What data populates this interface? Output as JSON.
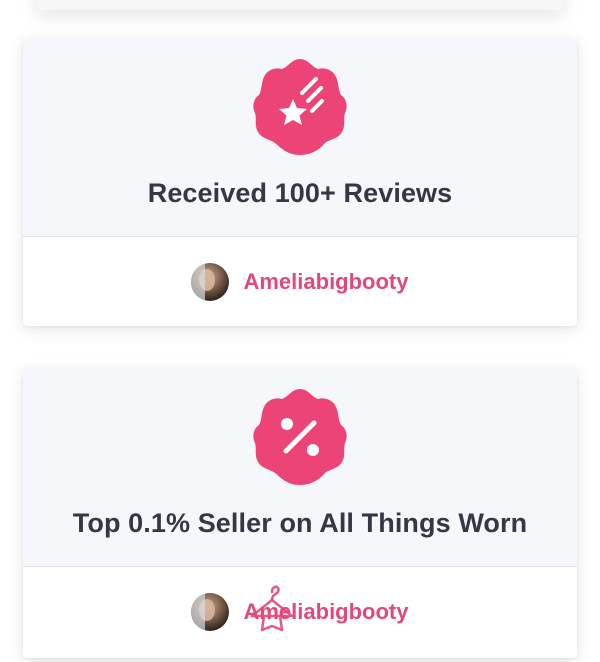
{
  "cards": [
    {
      "title": "Received 100+ Reviews",
      "badge_icon": "shooting-star-icon",
      "username": "Ameliabigbooty"
    },
    {
      "title": "Top 0.1% Seller on All Things Worn",
      "badge_icon": "percent-icon",
      "username": "Ameliabigbooty"
    }
  ],
  "colors": {
    "accent": "#ec4476",
    "title_text": "#343746",
    "card_header_bg": "#f6f7fa"
  },
  "watermark_icon": "hanger-icon"
}
